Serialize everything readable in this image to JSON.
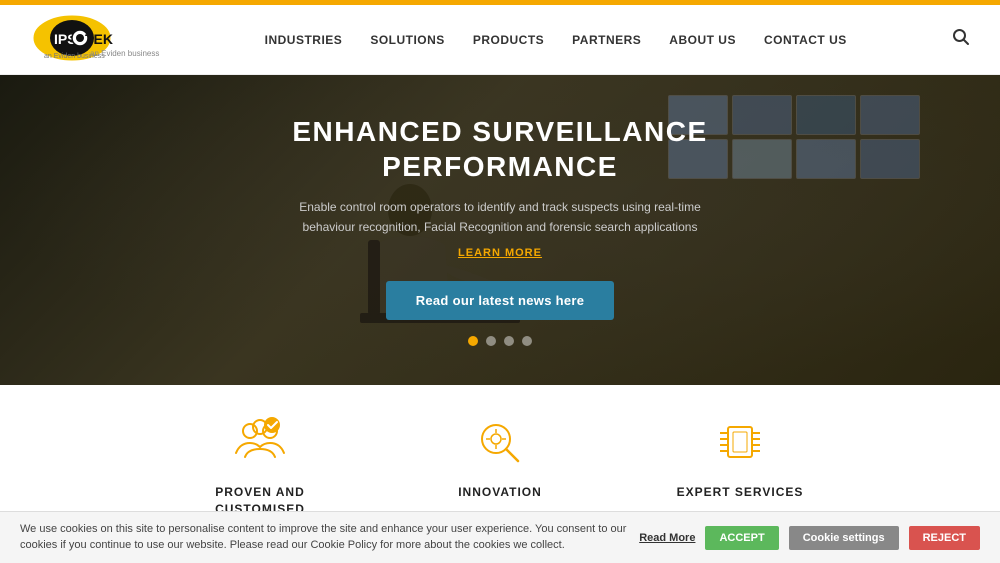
{
  "topBar": {},
  "header": {
    "logo": {
      "brand": "IPSOTEK",
      "sub": "an Eviden business"
    },
    "nav": {
      "items": [
        {
          "label": "INDUSTRIES",
          "id": "industries"
        },
        {
          "label": "SOLUTIONS",
          "id": "solutions"
        },
        {
          "label": "PRODUCTS",
          "id": "products"
        },
        {
          "label": "PARTNERS",
          "id": "partners"
        },
        {
          "label": "ABOUT US",
          "id": "about-us"
        },
        {
          "label": "CONTACT US",
          "id": "contact-us"
        }
      ]
    },
    "search_icon": "🔍"
  },
  "hero": {
    "title_line1": "ENHANCED SURVEILLANCE",
    "title_line2": "PERFORMANCE",
    "description": "Enable control room operators to identify and track suspects using real-time behaviour recognition, Facial Recognition and forensic search applications",
    "learn_more": "LEARN MORE",
    "cta_button": "Read our latest news here",
    "dots": [
      {
        "active": true
      },
      {
        "active": false
      },
      {
        "active": false
      },
      {
        "active": false
      }
    ]
  },
  "features": [
    {
      "id": "proven",
      "title_line1": "PROVEN AND",
      "title_line2": "CUSTOMISED SOLUTIONS",
      "icon": "team"
    },
    {
      "id": "innovation",
      "title_line1": "INNOVATION",
      "title_line2": "",
      "icon": "search-gear"
    },
    {
      "id": "expert",
      "title_line1": "EXPERT SERVICES",
      "title_line2": "",
      "icon": "circuit"
    }
  ],
  "cookieBar": {
    "text": "We use cookies on this site to personalise content to improve the site and enhance your user experience. You consent to our cookies if you continue to use our website. Please read our Cookie Policy for more about the cookies we collect.",
    "read_more": "Read More",
    "accept": "ACCEPT",
    "settings": "Cookie settings",
    "reject": "REJECT"
  }
}
